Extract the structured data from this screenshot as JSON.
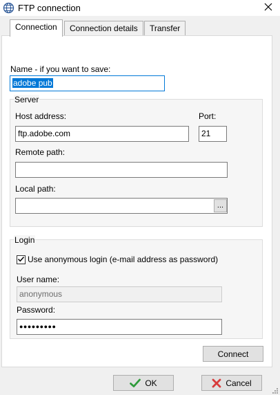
{
  "window": {
    "title": "FTP connection",
    "icon": "globe-icon",
    "close_icon": "close-icon"
  },
  "tabs": [
    {
      "label": "Connection",
      "active": true
    },
    {
      "label": "Connection details",
      "active": false
    },
    {
      "label": "Transfer",
      "active": false
    }
  ],
  "connection": {
    "name_label": "Name - if you want to save:",
    "name_value": "adobe pub",
    "server_group": "Server",
    "host_label": "Host address:",
    "host_value": "ftp.adobe.com",
    "port_label": "Port:",
    "port_value": "21",
    "remote_path_label": "Remote path:",
    "remote_path_value": "",
    "local_path_label": "Local path:",
    "local_path_value": "",
    "browse_label": "...",
    "login_group": "Login",
    "anonymous_label": "Use anonymous login (e-mail address as password)",
    "anonymous_checked": true,
    "username_label": "User name:",
    "username_value": "anonymous",
    "password_label": "Password:",
    "password_value": "●●●●●●●●●",
    "connect_label": "Connect"
  },
  "footer": {
    "ok_label": "OK",
    "ok_icon": "check-icon",
    "cancel_label": "Cancel",
    "cancel_icon": "x-icon"
  },
  "colors": {
    "accent": "#0078d7",
    "ok_green": "#2e9b3a",
    "cancel_red": "#d83b3b"
  }
}
